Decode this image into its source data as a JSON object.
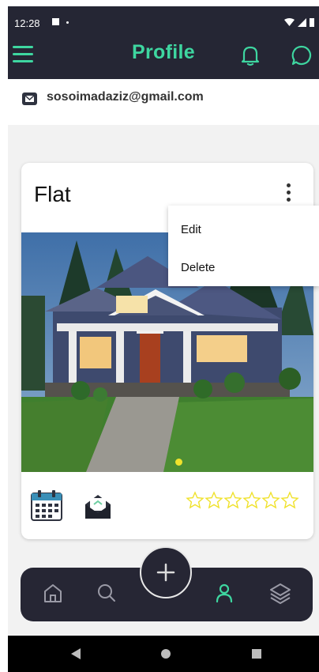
{
  "status_bar": {
    "time": "12:28"
  },
  "app_bar": {
    "title": "Profile",
    "menu_icon": "hamburger-menu-icon",
    "notification_icon": "bell-icon",
    "chat_icon": "chat-bubble-icon"
  },
  "profile": {
    "email": "sosoimadaziz@gmail.com",
    "email_icon": "mail-icon"
  },
  "listing_card": {
    "title": "Flat",
    "more_icon": "vertical-dots-icon",
    "image_description_icon": "house-photo",
    "carousel_page_indicator_color": "#f0e22c",
    "calendar_icon": "calendar-icon",
    "message_icon": "envelope-icon",
    "rating": {
      "value": 0,
      "max": 6
    }
  },
  "context_menu": {
    "items": [
      {
        "label": "Edit"
      },
      {
        "label": "Delete"
      }
    ]
  },
  "bottom_nav": {
    "items": [
      {
        "icon": "home-icon"
      },
      {
        "icon": "search-icon"
      },
      {
        "icon": "add-icon"
      },
      {
        "icon": "profile-icon",
        "active": true
      },
      {
        "icon": "layers-icon"
      }
    ]
  },
  "colors": {
    "accent": "#3ed6a0",
    "app_bar_bg": "#252634",
    "bottom_nav_bg": "#262634",
    "star_outline": "#f0e22c"
  }
}
